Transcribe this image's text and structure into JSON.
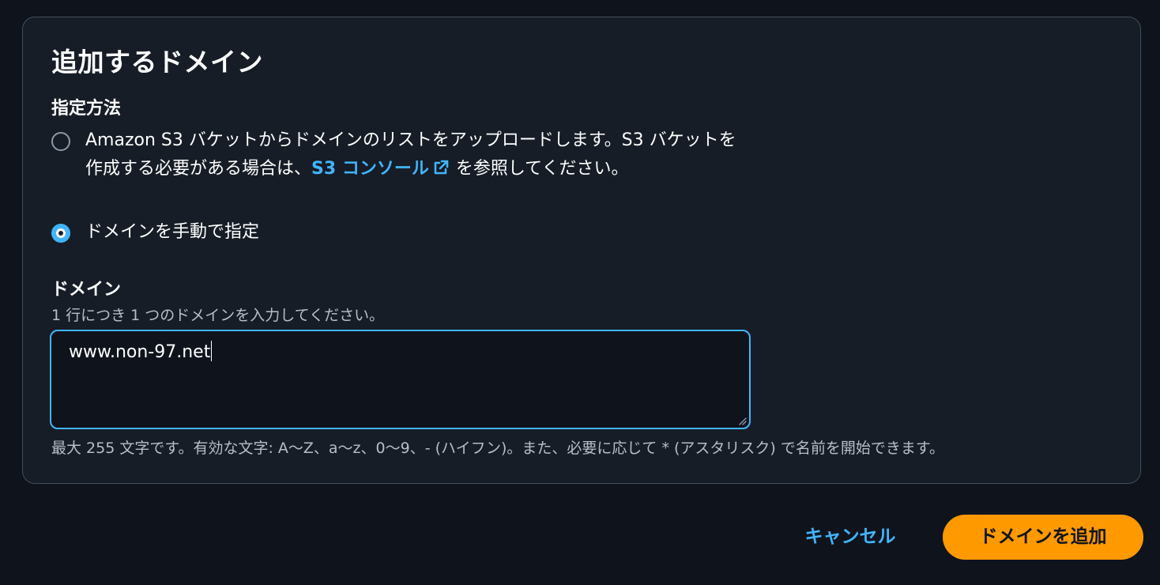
{
  "panel": {
    "title": "追加するドメイン",
    "method_label": "指定方法",
    "options": [
      {
        "text_before": "Amazon S3 バケットからドメインのリストをアップロードします。S3 バケットを作成する必要がある場合は、",
        "link_text": "S3 コンソール",
        "link_icon": "external-link-icon",
        "text_after": "を参照してください。",
        "selected": false
      },
      {
        "text": "ドメインを手動で指定",
        "selected": true
      }
    ],
    "domain_field": {
      "label": "ドメイン",
      "description": "1 行につき 1 つのドメインを入力してください。",
      "value": "www.non-97.net",
      "constraint": "最大 255 文字です。有効な文字: A〜Z、a〜z、0〜9、- (ハイフン)。また、必要に応じて * (アスタリスク) で名前を開始できます。"
    }
  },
  "footer": {
    "cancel_label": "キャンセル",
    "add_label": "ドメインを追加"
  },
  "colors": {
    "background": "#0f141c",
    "panel": "#161d26",
    "accent": "#42b4ff",
    "primary_button": "#ff9900"
  }
}
